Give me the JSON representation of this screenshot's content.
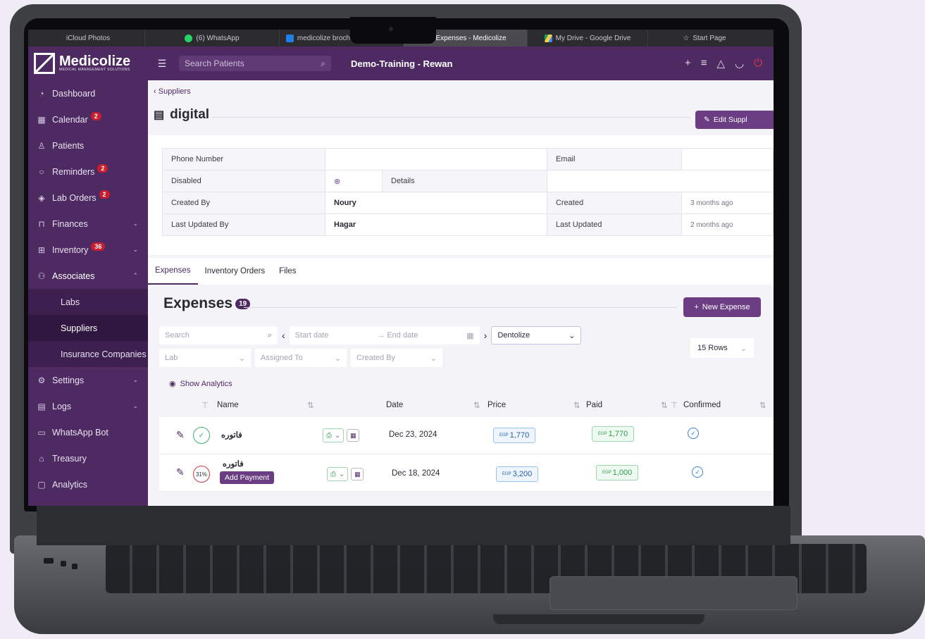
{
  "browser_tabs": [
    {
      "label": "iCloud Photos",
      "icon": "apple-icon"
    },
    {
      "label": "(6) WhatsApp",
      "icon": "whatsapp-icon"
    },
    {
      "label": "medicolize brochure English c...",
      "icon": "trello-icon"
    },
    {
      "label": "Expenses - Medicolize",
      "icon": "medicolize-icon",
      "active": true
    },
    {
      "label": "My Drive - Google Drive",
      "icon": "drive-icon"
    },
    {
      "label": "Start Page",
      "icon": "star-icon"
    }
  ],
  "brand": {
    "name": "Medicolize",
    "tagline": "MEDICAL MANAGEMENT SOLUTIONS",
    "color": "#4e2a63"
  },
  "topbar": {
    "search_placeholder": "Search Patients",
    "clinic": "Demo-Training - Rewan"
  },
  "sidebar": {
    "items": [
      {
        "label": "Dashboard",
        "icon": "gauge-icon"
      },
      {
        "label": "Calendar",
        "icon": "calendar-icon",
        "badge": "2"
      },
      {
        "label": "Patients",
        "icon": "user-icon"
      },
      {
        "label": "Reminders",
        "icon": "bell-icon",
        "badge": "2"
      },
      {
        "label": "Lab Orders",
        "icon": "cube-icon",
        "badge": "2"
      },
      {
        "label": "Finances",
        "icon": "receipt-icon"
      },
      {
        "label": "Inventory",
        "icon": "flask-icon",
        "badge": "36"
      },
      {
        "label": "Associates",
        "icon": "people-icon"
      },
      {
        "label": "Settings",
        "icon": "gear-icon"
      },
      {
        "label": "Logs",
        "icon": "log-icon"
      },
      {
        "label": "WhatsApp Bot",
        "icon": "chat-icon"
      },
      {
        "label": "Treasury",
        "icon": "bank-icon"
      },
      {
        "label": "Analytics",
        "icon": "monitor-icon"
      }
    ],
    "sub_items": [
      {
        "label": "Labs"
      },
      {
        "label": "Suppliers"
      },
      {
        "label": "Insurance Companies"
      }
    ]
  },
  "page": {
    "breadcrumb": "Suppliers",
    "title": "digital",
    "edit_button": "Edit Suppl"
  },
  "info": {
    "phone_label": "Phone Number",
    "email_label": "Email",
    "disabled_label": "Disabled",
    "details_label": "Details",
    "created_by_label": "Created By",
    "created_by": "Noury",
    "created_label": "Created",
    "created": "3 months ago",
    "updated_by_label": "Last Updated By",
    "updated_by": "Hagar",
    "updated_label": "Last Updated",
    "updated": "2 months ago"
  },
  "tabs": [
    "Expenses",
    "Inventory Orders",
    "Files"
  ],
  "expenses": {
    "title": "Expenses",
    "count": "19",
    "new_button": "New Expense",
    "search_placeholder": "Search",
    "start_date": "Start date",
    "end_date": "End date",
    "clinic_select": "Dentolize",
    "rows_select": "15 Rows",
    "lab_filter": "Lab",
    "assigned_filter": "Assigned To",
    "created_filter": "Created By",
    "show_analytics": "Show Analytics",
    "columns": [
      "Name",
      "Date",
      "Price",
      "Paid",
      "Confirmed"
    ],
    "rows": [
      {
        "name": "فاتوره",
        "date": "Dec 23, 2024",
        "currency": "EGP",
        "price": "1,770",
        "paid": "1,770",
        "status": "paid"
      },
      {
        "name": "فاتوره",
        "date": "Dec 18, 2024",
        "currency": "EGP",
        "price": "3,200",
        "paid": "1,000",
        "status": "31%",
        "action": "Add Payment"
      }
    ]
  }
}
